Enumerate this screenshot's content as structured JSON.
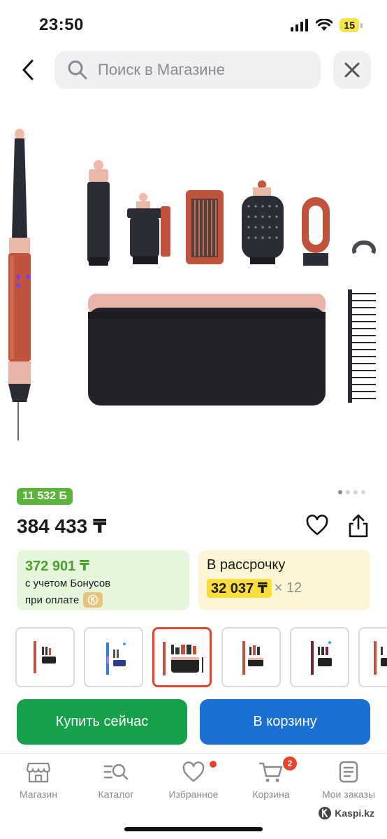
{
  "status_bar": {
    "time": "23:50",
    "battery": "15",
    "icons": [
      "signal-icon",
      "wifi-icon",
      "battery-icon"
    ]
  },
  "header": {
    "search_placeholder": "Поиск в Магазине"
  },
  "gallery": {
    "pages": 4,
    "active_page": 1
  },
  "product": {
    "bonus_badge": "11 532 Б",
    "price": "384 433 ₸"
  },
  "bonus_card": {
    "amount": "372 901 ₸",
    "line1": "с учетом Бонусов",
    "line2": "при оплате"
  },
  "credit_card": {
    "title": "В рассрочку",
    "monthly": "32 037 ₸",
    "multiplier": "× 12"
  },
  "thumbnails": {
    "count": 6,
    "selected_index": 2
  },
  "actions": {
    "buy_label": "Купить сейчас",
    "cart_label": "В корзину"
  },
  "tabbar": {
    "items": [
      {
        "label": "Магазин",
        "icon": "shop-icon"
      },
      {
        "label": "Каталог",
        "icon": "catalog-search-icon"
      },
      {
        "label": "Избранное",
        "icon": "heart-icon"
      },
      {
        "label": "Корзина",
        "icon": "cart-icon",
        "badge": "2"
      },
      {
        "label": "Мои заказы",
        "icon": "orders-icon"
      }
    ]
  },
  "watermark": "Kaspi.kz",
  "colors": {
    "bonus_green": "#5bb33a",
    "buy_green": "#17a04a",
    "cart_blue": "#1a6fd0",
    "credit_yellow": "#f9dd3c",
    "badge_red": "#e8432b"
  }
}
